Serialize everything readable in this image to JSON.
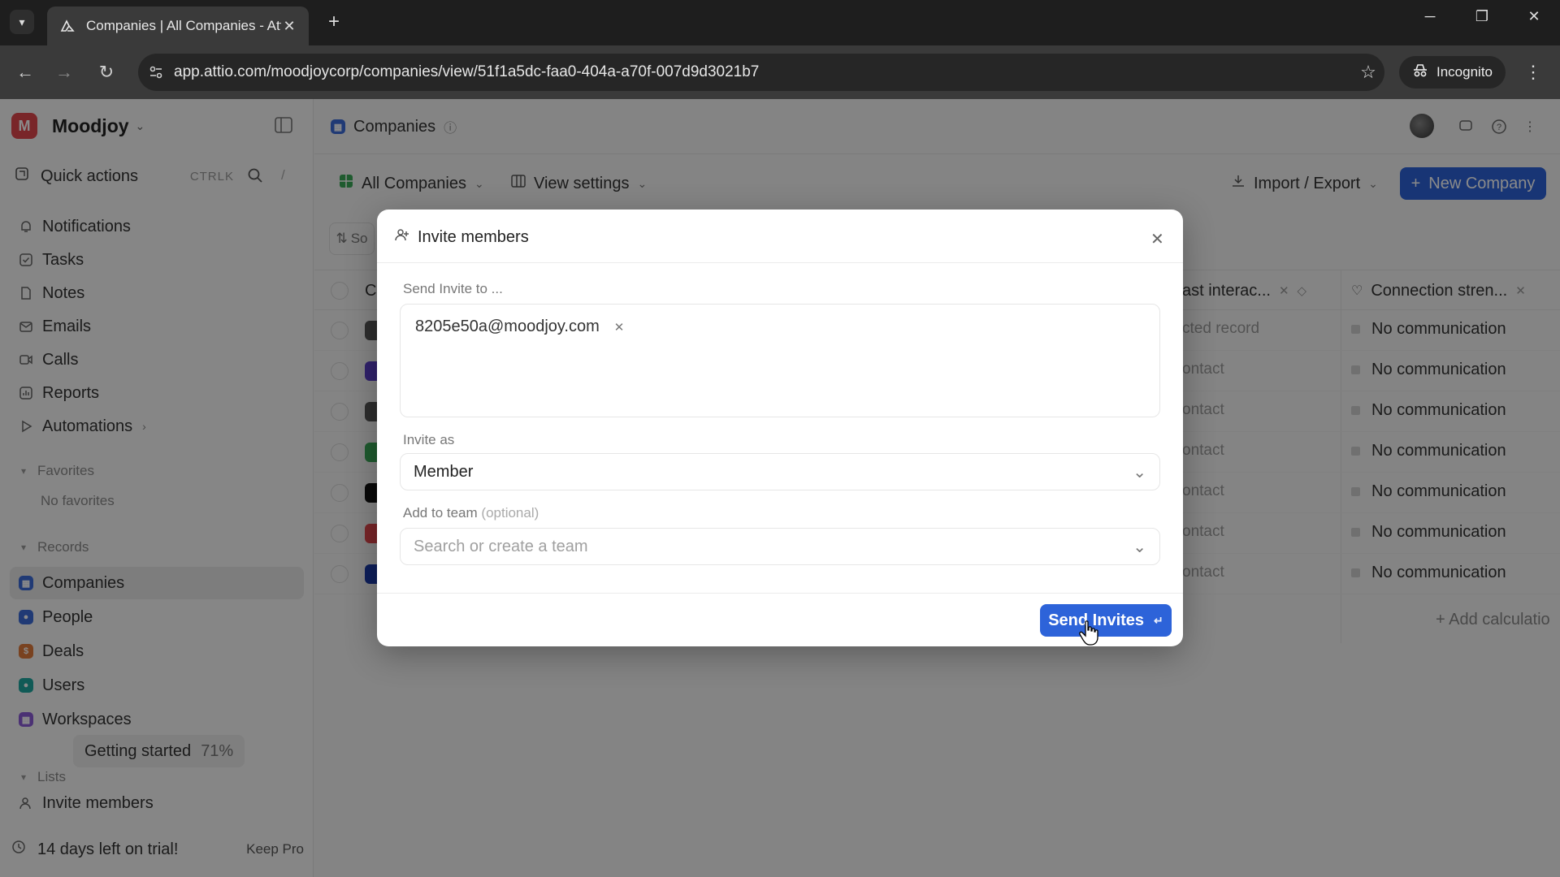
{
  "browser": {
    "tab_title": "Companies | All Companies - Attio",
    "url": "app.attio.com/moodjoycorp/companies/view/51f1a5dc-faa0-404a-a70f-007d9d3021b7",
    "incognito_label": "Incognito"
  },
  "sidebar": {
    "workspace_name": "Moodjoy",
    "workspace_initial": "M",
    "quick_actions": {
      "label": "Quick actions",
      "shortcut": "CTRLK",
      "slash": "/"
    },
    "nav": [
      {
        "label": "Notifications"
      },
      {
        "label": "Tasks"
      },
      {
        "label": "Notes"
      },
      {
        "label": "Emails"
      },
      {
        "label": "Calls"
      },
      {
        "label": "Reports"
      },
      {
        "label": "Automations"
      }
    ],
    "favorites": {
      "title": "Favorites",
      "empty": "No favorites"
    },
    "records": {
      "title": "Records",
      "items": [
        {
          "label": "Companies",
          "color": "#3b6cd8"
        },
        {
          "label": "People",
          "color": "#3b6cd8"
        },
        {
          "label": "Deals",
          "color": "#e07a3c"
        },
        {
          "label": "Users",
          "color": "#1fa7a0"
        },
        {
          "label": "Workspaces",
          "color": "#8b5cd6"
        }
      ]
    },
    "getting_started": {
      "label": "Getting started",
      "percent": "71%"
    },
    "lists": {
      "title": "Lists"
    },
    "invite_members": "Invite members",
    "trial": {
      "label": "14 days left on trial!",
      "action": "Keep Pro"
    }
  },
  "main": {
    "breadcrumb": "Companies",
    "view_name": "All Companies",
    "view_settings": "View settings",
    "import_export": "Import / Export",
    "new_company": "New Company",
    "sort_label": "So",
    "columns": {
      "first": "C",
      "last_interaction": "ast interac...",
      "connection_strength": "Connection stren..."
    },
    "rows": [
      {
        "last_interaction": "cted record",
        "connection": "No communication",
        "logo_color": "#555555"
      },
      {
        "last_interaction": "ontact",
        "connection": "No communication",
        "logo_color": "#5b3fc7"
      },
      {
        "last_interaction": "ontact",
        "connection": "No communication",
        "logo_color": "#555555"
      },
      {
        "last_interaction": "ontact",
        "connection": "No communication",
        "logo_color": "#3aa857"
      },
      {
        "last_interaction": "ontact",
        "connection": "No communication",
        "logo_color": "#111111"
      },
      {
        "last_interaction": "ontact",
        "connection": "No communication",
        "logo_color": "#e0474c"
      },
      {
        "last_interaction": "ontact",
        "connection": "No communication",
        "logo_color": "#1a3aa8"
      }
    ],
    "add_calculation": "+ Add calculatio"
  },
  "modal": {
    "title": "Invite members",
    "send_to_label": "Send Invite to ...",
    "email_chip": "8205e50a@moodjoy.com",
    "invite_as_label": "Invite as",
    "invite_as_value": "Member",
    "add_team_label": "Add to team",
    "add_team_optional": "(optional)",
    "team_placeholder": "Search or create a team",
    "send_button": "Send Invites",
    "send_shortcut": "↵"
  },
  "colors": {
    "accent": "#2d63d9",
    "brand_red": "#e0474c"
  }
}
